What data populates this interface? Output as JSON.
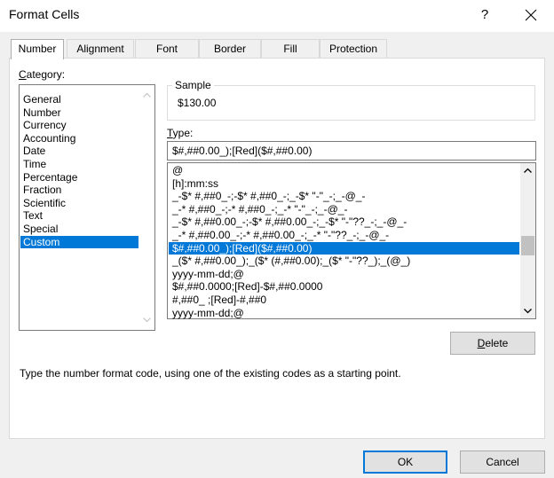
{
  "window": {
    "title": "Format Cells",
    "help_label": "?",
    "close_icon": "close-icon"
  },
  "tabs": [
    {
      "label": "Number",
      "active": true
    },
    {
      "label": "Alignment",
      "active": false
    },
    {
      "label": "Font",
      "active": false
    },
    {
      "label": "Border",
      "active": false
    },
    {
      "label": "Fill",
      "active": false
    },
    {
      "label": "Protection",
      "active": false
    }
  ],
  "category": {
    "label_prefix": "",
    "label_access": "C",
    "label_rest": "ategory:",
    "items": [
      "General",
      "Number",
      "Currency",
      "Accounting",
      "Date",
      "Time",
      "Percentage",
      "Fraction",
      "Scientific",
      "Text",
      "Special",
      "Custom"
    ],
    "selected": "Custom"
  },
  "sample": {
    "title": "Sample",
    "value": "$130.00"
  },
  "type": {
    "label_access": "T",
    "label_rest": "ype:",
    "value": "$#,##0.00_);[Red]($#,##0.00)"
  },
  "formats": {
    "items": [
      "@",
      "[h]:mm:ss",
      "_-$* #,##0_-;-$* #,##0_-;_-$* \"-\"_-;_-@_-",
      "_-* #,##0_-;-* #,##0_-;_-* \"-\"_-;_-@_-",
      "_-$* #,##0.00_-;-$* #,##0.00_-;_-$* \"-\"??_-;_-@_-",
      "_-* #,##0.00_-;-* #,##0.00_-;_-* \"-\"??_-;_-@_-",
      "$#,##0.00_);[Red]($#,##0.00)",
      "_($* #,##0.00_);_($* (#,##0.00);_($* \"-\"??_);_(@_)",
      "yyyy-mm-dd;@",
      "$#,##0.0000;[Red]-$#,##0.0000",
      "#,##0_ ;[Red]-#,##0",
      "yyyy-mm-dd;@"
    ],
    "selected_index": 6
  },
  "buttons": {
    "delete_access": "D",
    "delete_rest": "elete",
    "ok": "OK",
    "cancel": "Cancel"
  },
  "hint": "Type the number format code, using one of the existing codes as a starting point.",
  "colors": {
    "selection": "#0078d7",
    "panel": "#f0f0f0"
  }
}
